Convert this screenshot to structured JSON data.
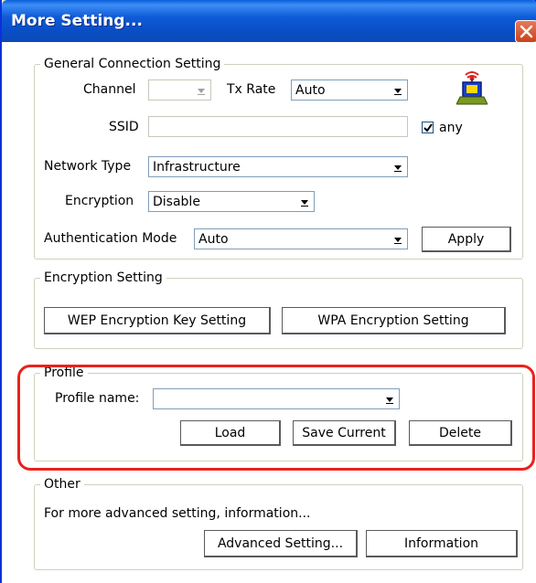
{
  "window": {
    "title": "More Setting...",
    "close_icon": "close-icon"
  },
  "general": {
    "title": "General Connection Setting",
    "channel_label": "Channel",
    "channel_value": "",
    "txrate_label": "Tx Rate",
    "txrate_value": "Auto",
    "ssid_label": "SSID",
    "ssid_value": "",
    "any_label": "any",
    "any_checked": true,
    "network_type_label": "Network Type",
    "network_type_value": "Infrastructure",
    "encryption_label": "Encryption",
    "encryption_value": "Disable",
    "auth_mode_label": "Authentication Mode",
    "auth_mode_value": "Auto",
    "apply_label": "Apply",
    "network_icon": "wireless-network-icon"
  },
  "encryption_setting": {
    "title": "Encryption Setting",
    "wep_button": "WEP Encryption Key Setting",
    "wpa_button": "WPA Encryption Setting"
  },
  "profile": {
    "title": "Profile",
    "name_label": "Profile name:",
    "name_value": "",
    "load_button": "Load",
    "save_button": "Save Current",
    "delete_button": "Delete"
  },
  "other": {
    "title": "Other",
    "description": "For more advanced setting, information...",
    "advanced_button": "Advanced Setting...",
    "information_button": "Information"
  },
  "colors": {
    "titlebar": "#0a4fc8",
    "highlight": "#e8221e",
    "window_bg": "#ffffff"
  }
}
